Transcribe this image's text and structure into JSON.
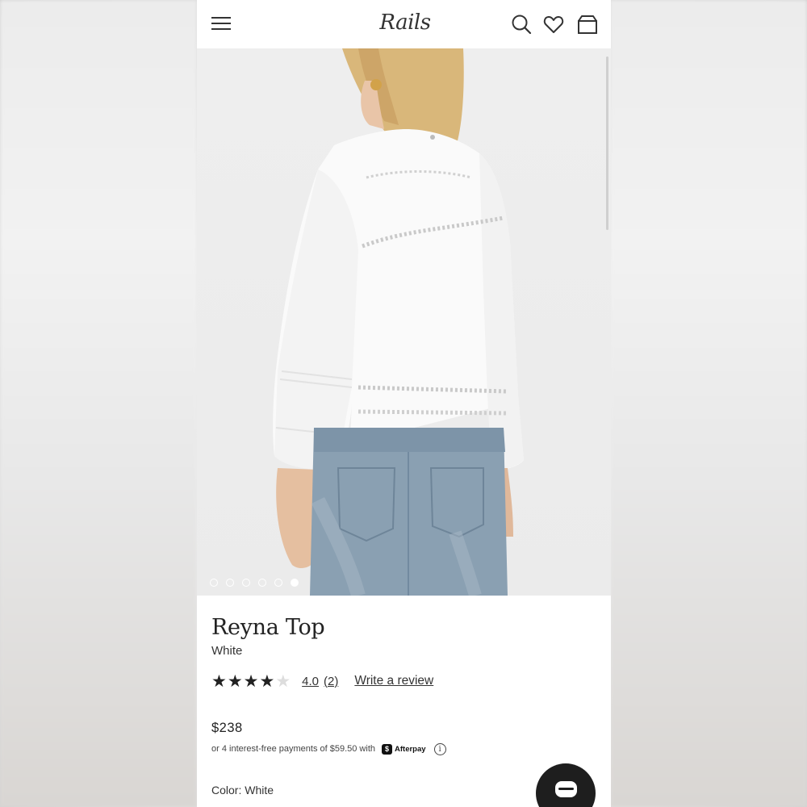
{
  "header": {
    "logo_text": "Rails",
    "menu_icon": "hamburger-menu-icon",
    "search_icon": "search-icon",
    "wishlist_icon": "heart-icon",
    "bag_icon": "shopping-bag-icon"
  },
  "gallery": {
    "image_count": 6,
    "active_index": 5,
    "image_description_icon": "product-photo"
  },
  "product": {
    "title": "Reyna Top",
    "variant": "White",
    "rating_value": "4.0",
    "rating_count": "(2)",
    "rating_stars": 4,
    "write_review": "Write a review",
    "price": "$238",
    "installments": "or 4 interest-free payments of $59.50 with",
    "afterpay_label": "Afterpay",
    "afterpay_logo": "$",
    "info_icon": "i",
    "color_label": "Color: White"
  },
  "chat": {
    "icon": "chat-bubble-icon"
  },
  "colors": {
    "background": "#ffffff",
    "text": "#222222",
    "chat_button": "#1e1e1e"
  }
}
